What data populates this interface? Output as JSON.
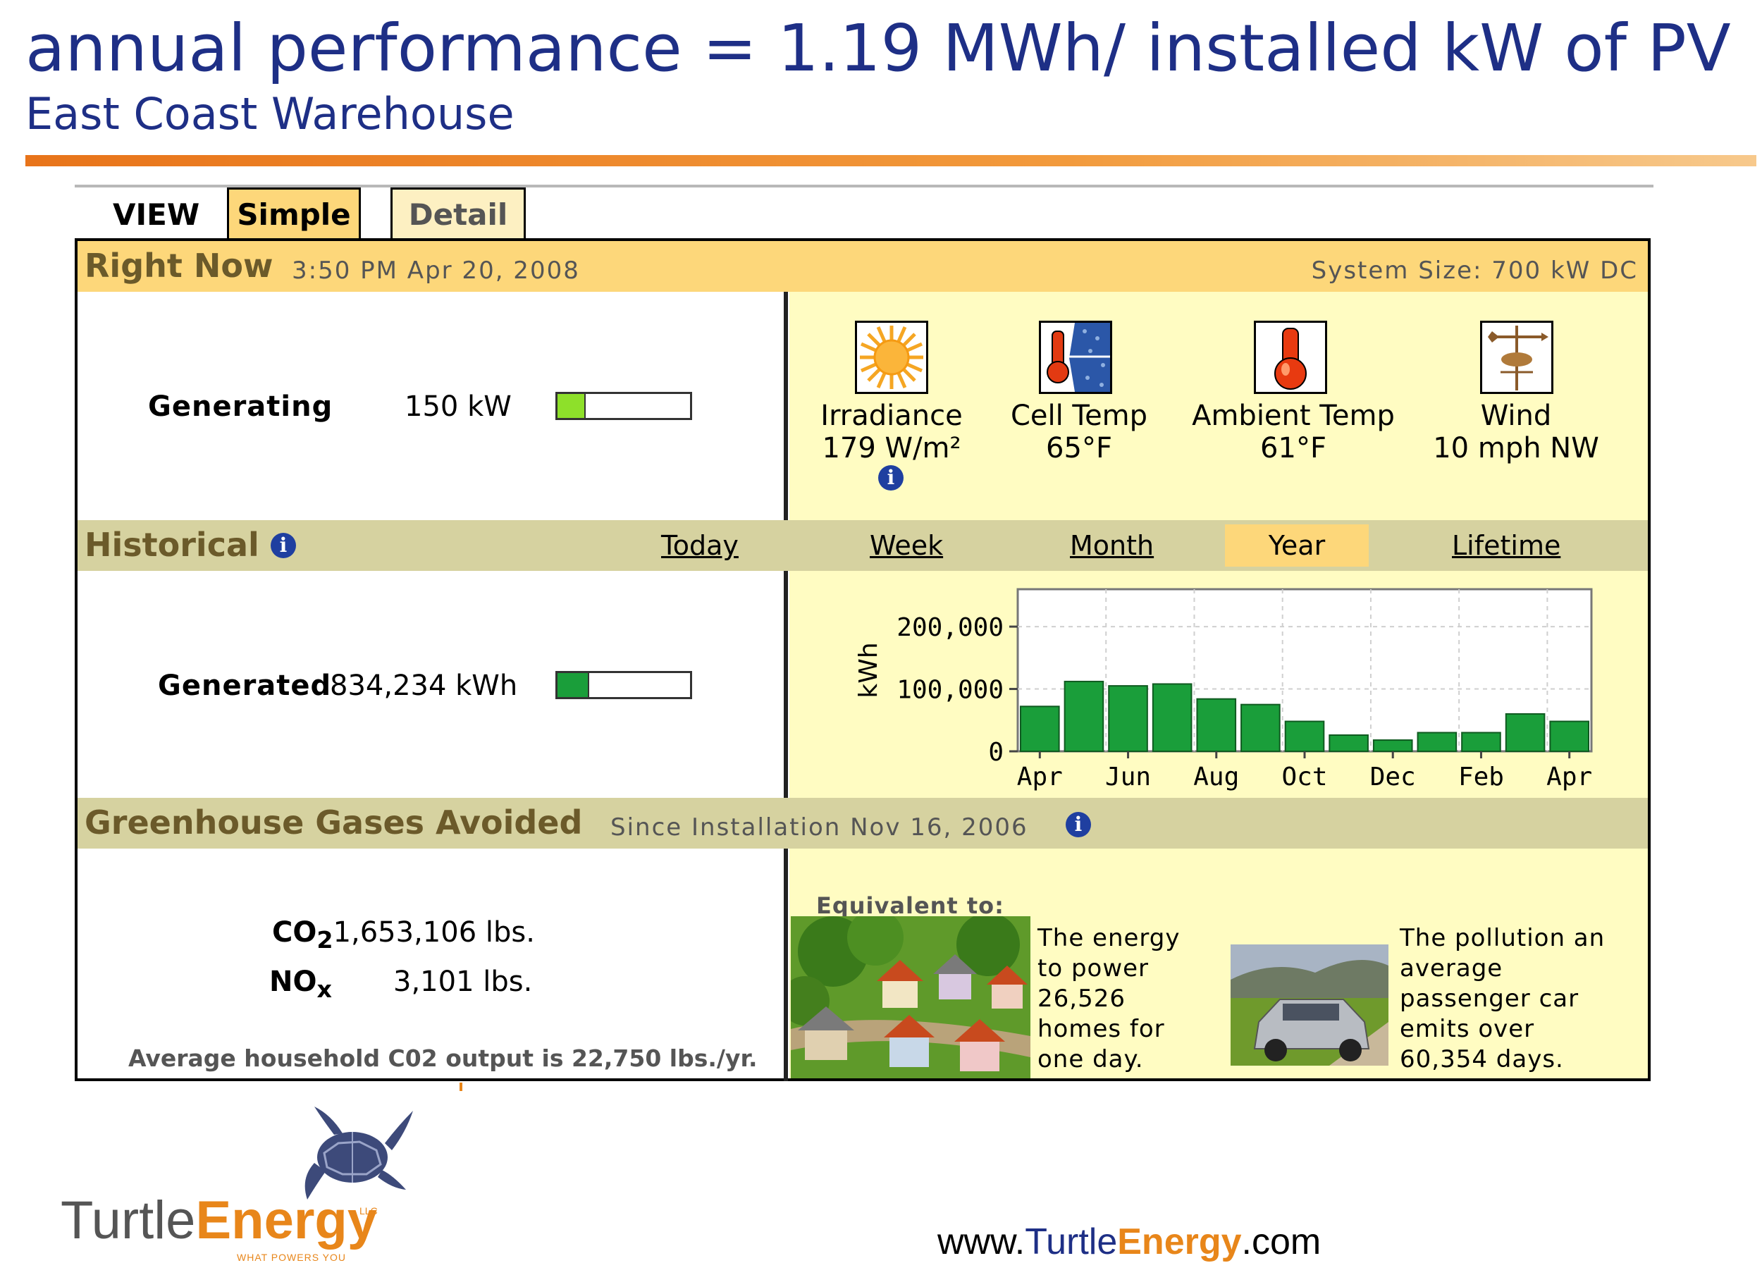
{
  "slide": {
    "title": "annual performance = 1.19 MWh/ installed kW of PV",
    "subtitle": "East Coast Warehouse"
  },
  "tabs": {
    "view_label": "VIEW",
    "items": [
      {
        "label": "Simple",
        "selected": true
      },
      {
        "label": "Detail",
        "selected": false
      }
    ]
  },
  "right_now": {
    "title": "Right Now",
    "timestamp": "3:50 PM Apr 20, 2008",
    "system_size": "System Size: 700 kW DC",
    "generating_label": "Generating",
    "generating_value": "150 kW",
    "generating_fraction": 0.2143,
    "weather": [
      {
        "name": "Irradiance",
        "value": "179 W/m²",
        "icon": "sun-icon",
        "has_info": true
      },
      {
        "name": "Cell Temp",
        "value": "65°F",
        "icon": "cell-thermometer-icon",
        "has_info": false
      },
      {
        "name": "Ambient Temp",
        "value": "61°F",
        "icon": "thermometer-icon",
        "has_info": false
      },
      {
        "name": "Wind",
        "value": "10 mph NW",
        "icon": "weathervane-icon",
        "has_info": false
      }
    ]
  },
  "historical": {
    "title": "Historical",
    "periods": [
      "Today",
      "Week",
      "Month",
      "Year",
      "Lifetime"
    ],
    "selected_period": "Year",
    "generated_label": "Generated",
    "generated_value": "834,234 kWh",
    "generated_fraction": 0.24
  },
  "chart_data": {
    "type": "bar",
    "ylabel": "kWh",
    "ylim": [
      0,
      260000
    ],
    "yticks": [
      "200,000",
      "100,000",
      "0"
    ],
    "ytick_values": [
      200000,
      100000,
      0
    ],
    "xtick_labels": [
      "Apr",
      "Jun",
      "Aug",
      "Oct",
      "Dec",
      "Feb",
      "Apr"
    ],
    "categories": [
      "Apr",
      "May",
      "Jun",
      "Jul",
      "Aug",
      "Sep",
      "Oct",
      "Nov",
      "Dec",
      "Jan",
      "Feb",
      "Mar",
      "Apr"
    ],
    "values": [
      72000,
      112000,
      105000,
      108000,
      84000,
      75000,
      48000,
      26000,
      18000,
      30000,
      30000,
      60000,
      48000
    ],
    "grid": true,
    "bar_color": "#1a9e3a"
  },
  "ghg": {
    "title": "Greenhouse Gases Avoided",
    "since": "Since Installation Nov 16, 2006",
    "co2_label": "CO",
    "co2_sub": "2",
    "co2_value": "1,653,106 lbs.",
    "nox_label": "NO",
    "nox_sub": "x",
    "nox_value": "3,101 lbs.",
    "household_note": "Average household C02 output is 22,750 lbs./yr.",
    "equivalent_label": "Equivalent to:",
    "homes_text": [
      "The energy",
      "to power",
      "26,526",
      "homes for",
      "one day."
    ],
    "car_text": [
      "The pollution an",
      "average",
      "passenger car",
      "emits over",
      "60,354 days."
    ]
  },
  "footer": {
    "logo_turtle": "Turtle",
    "logo_energy": "Energy",
    "logo_llc": "LLC",
    "logo_tagline": "WHAT POWERS YOU",
    "url_prefix": "www.",
    "url_turtle": "Turtle",
    "url_energy": "Energy",
    "url_suffix": ".com"
  },
  "colors": {
    "title_blue": "#1e2f86",
    "band_gold": "#fdd77a",
    "band_olive": "#d6d2a0",
    "pane_yellow": "#fffcc2",
    "bar_green": "#1a9e3a",
    "brand_orange": "#e8861a"
  }
}
